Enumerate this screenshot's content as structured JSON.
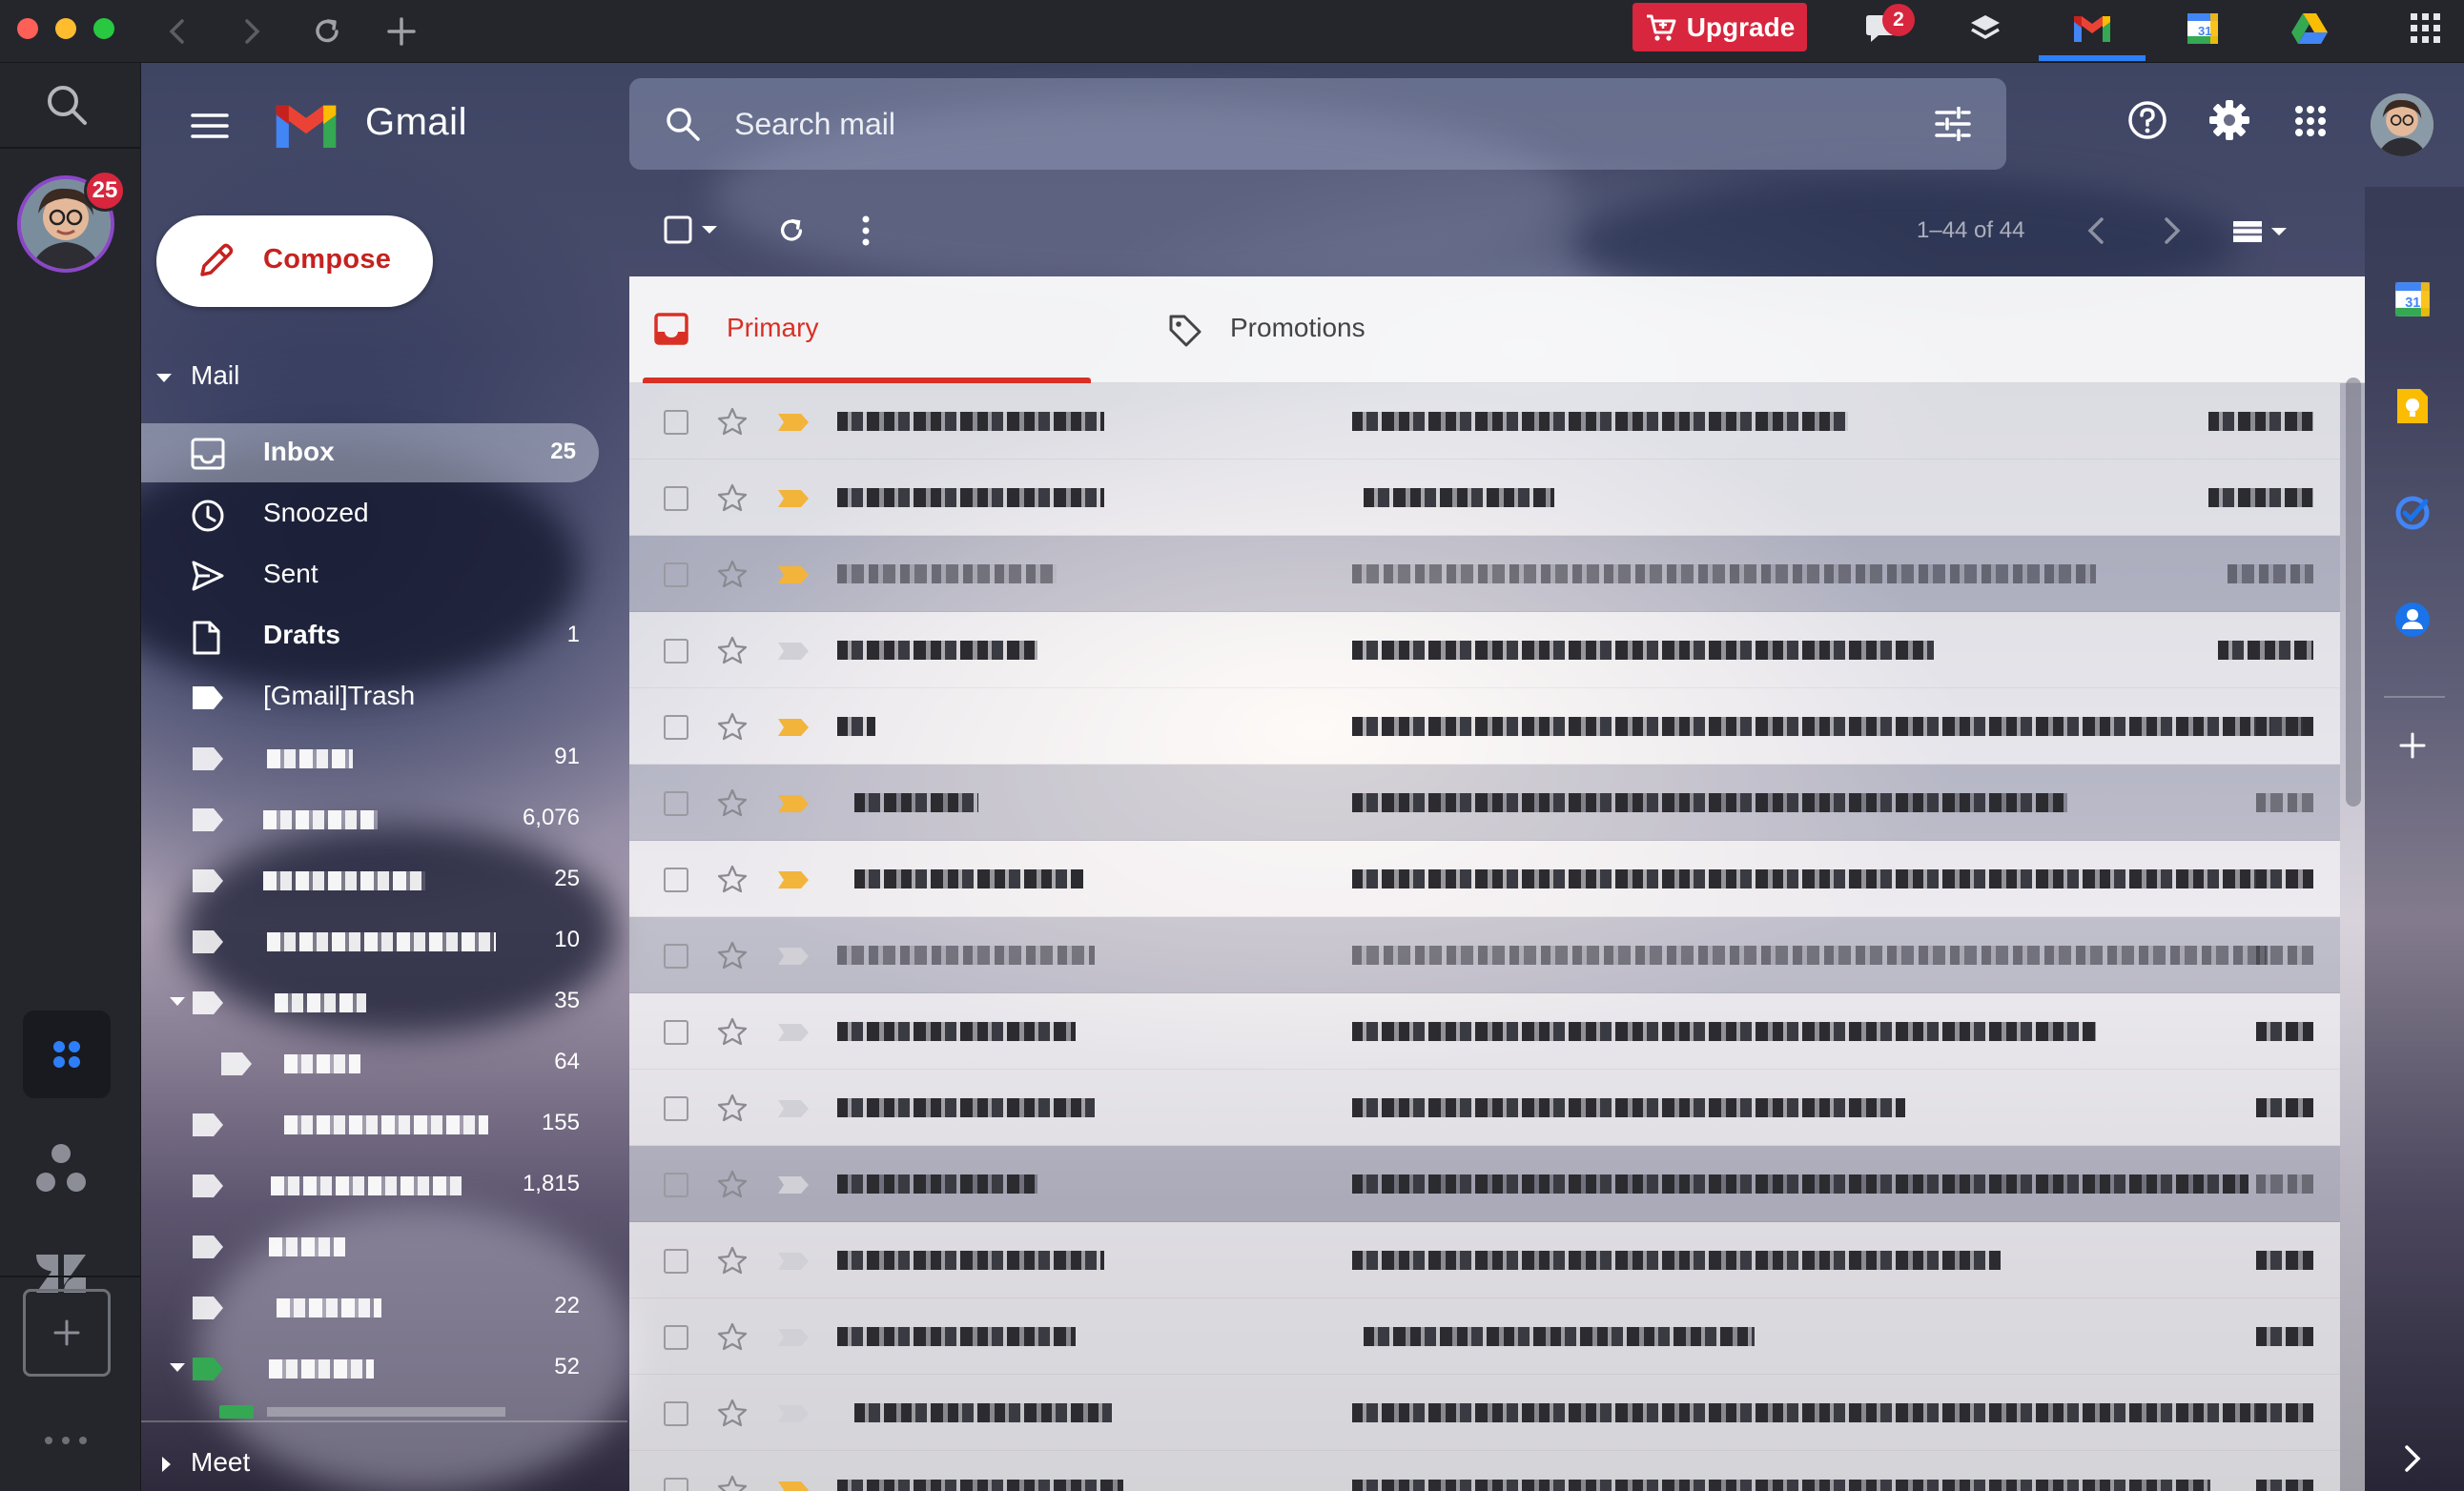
{
  "window": {
    "upgrade_label": "Upgrade",
    "chat_badge": "2",
    "rail_badge": "25"
  },
  "header": {
    "app_name": "Gmail",
    "search_placeholder": "Search mail"
  },
  "compose_label": "Compose",
  "sections": {
    "mail": "Mail",
    "meet": "Meet"
  },
  "nav": {
    "inbox": {
      "label": "Inbox",
      "count": "25"
    },
    "snoozed": {
      "label": "Snoozed"
    },
    "sent": {
      "label": "Sent"
    },
    "drafts": {
      "label": "Drafts",
      "count": "1"
    },
    "trash": {
      "label": "[Gmail]Trash"
    },
    "labels": [
      {
        "count": "91"
      },
      {
        "count": "6,076"
      },
      {
        "count": "25"
      },
      {
        "count": "10"
      },
      {
        "count": "35"
      },
      {
        "count": "64"
      },
      {
        "count": "155"
      },
      {
        "count": "1,815"
      },
      {
        "count": ""
      },
      {
        "count": "22"
      },
      {
        "count": "52"
      }
    ]
  },
  "toolbar": {
    "pager": "1–44 of 44"
  },
  "tabs": {
    "primary": "Primary",
    "promotions": "Promotions"
  },
  "colors": {
    "accent_red": "#d93025",
    "upgrade_red": "#d7263d",
    "important_marker": "#f2b43a",
    "active_tab_blue": "#2d7ff9"
  }
}
